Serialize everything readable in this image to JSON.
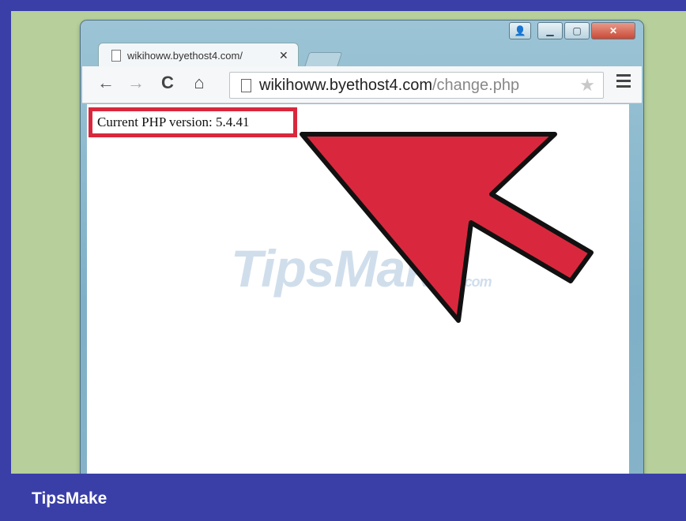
{
  "tab": {
    "title": "wikihoww.byethost4.com/",
    "close": "✕"
  },
  "toolbar": {
    "back": "←",
    "forward": "→",
    "reload": "C",
    "home": "⌂",
    "star": "★"
  },
  "address": {
    "host": "wikihoww.byethost4.com",
    "path": "/change.php"
  },
  "page": {
    "php_version_text": "Current PHP version: 5.4.41"
  },
  "watermark": {
    "main": "TipsMake",
    "suffix": ".com"
  },
  "footer": {
    "brand": "TipsMake"
  },
  "colors": {
    "highlight": "#d9283d",
    "arrow_fill": "#d9283d",
    "frame": "#3a3fa8",
    "scene_bg": "#b6cf9b"
  },
  "icons": [
    "page-icon",
    "back-arrow-icon",
    "forward-arrow-icon",
    "reload-icon",
    "home-icon",
    "star-icon",
    "menu-icon",
    "user-icon",
    "minimize-icon",
    "maximize-icon",
    "close-icon",
    "red-arrow-annotation"
  ]
}
